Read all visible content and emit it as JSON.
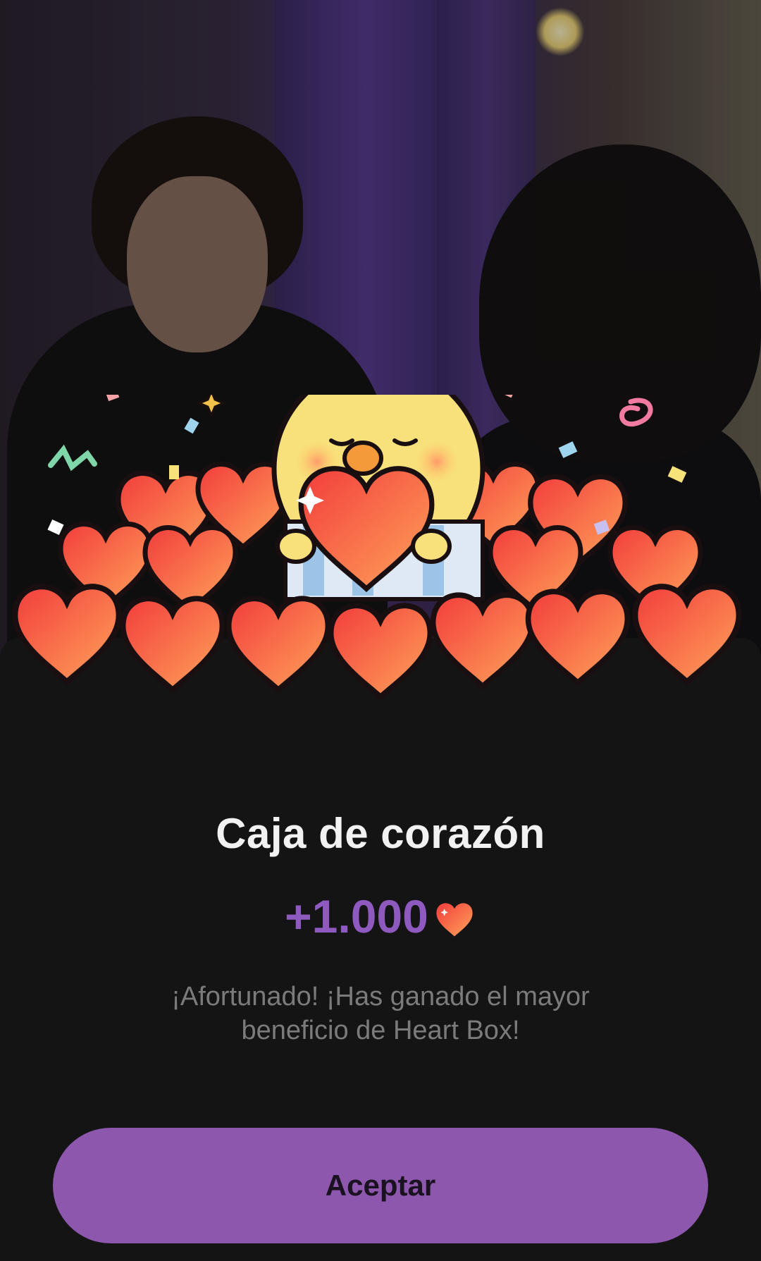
{
  "popup": {
    "title": "Caja de corazón",
    "reward_amount": "+1.000",
    "reward_icon": "heart-icon",
    "message": "¡Afortunado! ¡Has ganado el mayor beneficio de Heart Box!",
    "accept_label": "Aceptar"
  },
  "colors": {
    "accent": "#8C57AD",
    "reward_text": "#8E5AC0",
    "sheet_bg": "#141414",
    "title_text": "#F2F2F2",
    "message_text": "#7B7B7B",
    "heart_light": "#FFA45A",
    "heart_dark": "#F23C3C"
  },
  "illustration": {
    "name": "chick-holding-heart-with-heart-pile",
    "icon": "chick-mascot-icon"
  }
}
